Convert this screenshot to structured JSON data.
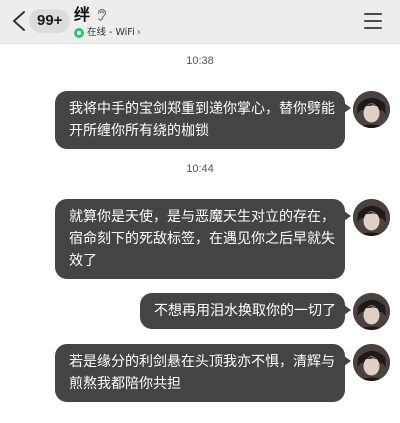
{
  "header": {
    "unread_count": "99+",
    "title": "绊",
    "status": "在线 - WiFi",
    "status_chevron": "›"
  },
  "messages": [
    {
      "time": "10:38",
      "text": "我将中手的宝剑郑重到递你掌心，替你劈能开所缠你所有绕的枷锁"
    },
    {
      "time": "10:44",
      "text": "就算你是天使，是与恶魔天生对立的存在，宿命刻下的死敌标签，在遇见你之后早就失效了"
    },
    {
      "text": "不想再用泪水换取你的一切了"
    },
    {
      "text": "若是缘分的利剑悬在头顶我亦不惧，清辉与煎熬我都陪你共担"
    }
  ],
  "colors": {
    "header_bg": "#ededed",
    "bubble_bg": "#444444",
    "bubble_text": "#ffffff",
    "online": "#2bc76a"
  },
  "icons": [
    "back-arrow-icon",
    "ear-icon",
    "online-status-icon",
    "menu-icon",
    "avatar"
  ]
}
